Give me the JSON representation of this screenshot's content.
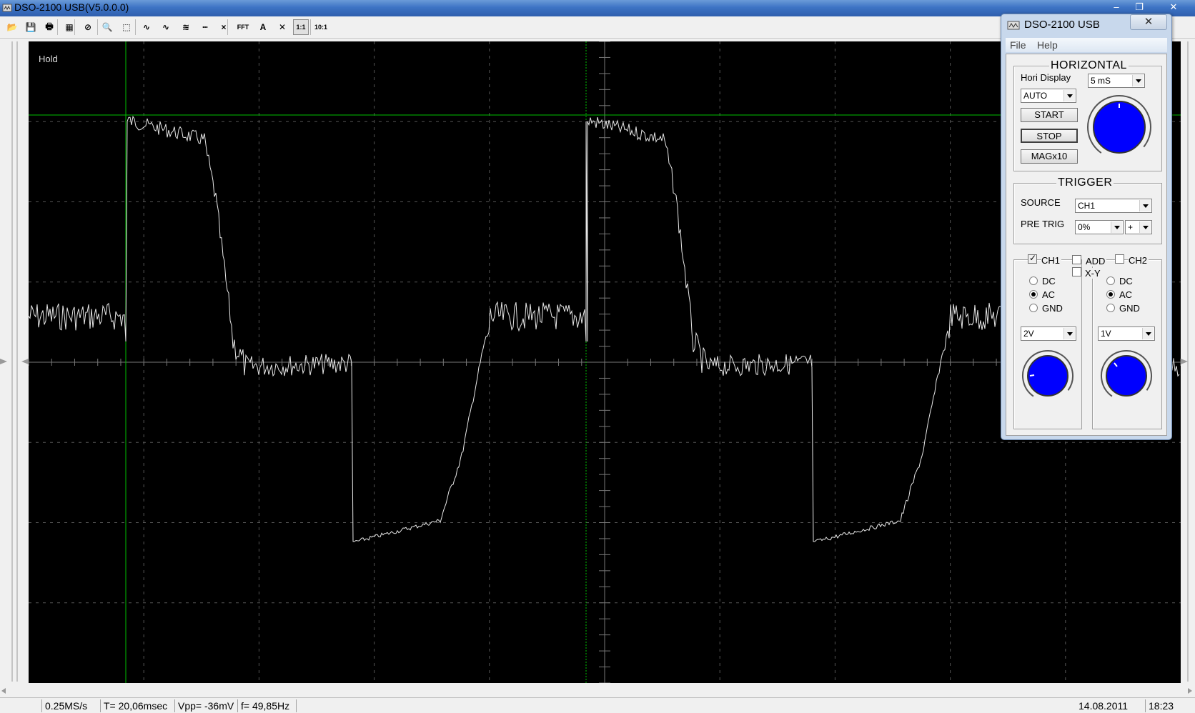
{
  "window": {
    "title": "DSO-2100 USB(V5.0.0.0)",
    "minimize": "–",
    "maximize": "❐",
    "close": "✕"
  },
  "toolbar": {
    "buttons": [
      {
        "icon": "open-folder-icon",
        "glyph": "📂"
      },
      {
        "icon": "save-icon",
        "glyph": "💾"
      },
      {
        "icon": "print-icon",
        "glyph": "🖶"
      },
      {
        "icon": "print-preview-icon",
        "glyph": "▦"
      },
      {
        "icon": "stop-icon",
        "glyph": "⊘"
      },
      {
        "icon": "zoom-icon",
        "glyph": "🔍"
      },
      {
        "icon": "select-area-icon",
        "glyph": "⬚"
      },
      {
        "icon": "wave-ch1-icon",
        "glyph": "∿"
      },
      {
        "icon": "wave-ch2-icon",
        "glyph": "∿"
      },
      {
        "icon": "wave-math-icon",
        "glyph": "≋"
      },
      {
        "icon": "dots-icon",
        "glyph": "┅"
      },
      {
        "icon": "marker-icon",
        "glyph": "×"
      },
      {
        "icon": "fft-icon",
        "glyph": "FFT"
      },
      {
        "icon": "auto-measure-icon",
        "glyph": "A"
      },
      {
        "icon": "clear-icon",
        "glyph": "✕"
      },
      {
        "icon": "probe-1x-icon",
        "glyph": "1:1"
      },
      {
        "icon": "probe-10x-icon",
        "glyph": "10:1"
      }
    ]
  },
  "scope": {
    "hold_label": "Hold",
    "trace_color": "#e8e8e8",
    "grid_color": "#555555",
    "cursor_color": "#00c000",
    "waveform": {
      "period_ms": 20.06,
      "timebase_ms_per_div": 5,
      "volts_per_div": 2
    }
  },
  "status": {
    "sample_rate": "0.25MS/s",
    "period": "T= 20,06msec",
    "vpp": "Vpp= -36mV",
    "freq": "f= 49,85Hz",
    "date": "14.08.2011",
    "time": "18:23"
  },
  "panel": {
    "title": "DSO-2100 USB",
    "close": "✕",
    "menu": {
      "file": "File",
      "help": "Help"
    },
    "horizontal": {
      "title": "HORIZONTAL",
      "hori_display_label": "Hori Display",
      "timebase": "5 mS",
      "mode": "AUTO",
      "start": "START",
      "stop": "STOP",
      "mag": "MAGx10"
    },
    "trigger": {
      "title": "TRIGGER",
      "source_label": "SOURCE",
      "source": "CH1",
      "pretrig_label": "PRE TRIG",
      "pretrig": "0%",
      "slope": "+"
    },
    "channels": {
      "ch1_label": "CH1",
      "add_label": "ADD",
      "ch2_label": "CH2",
      "xy_label": "X-Y",
      "dc_label": "DC",
      "ac_label": "AC",
      "gnd_label": "GND",
      "ch1_volts": "2V",
      "ch2_volts": "1V"
    },
    "knob_color": "#0000ff"
  }
}
